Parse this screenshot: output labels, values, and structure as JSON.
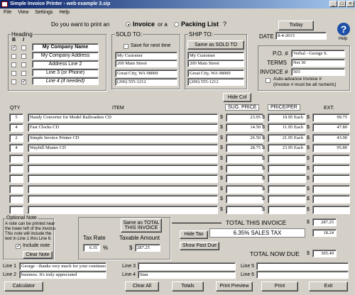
{
  "window": {
    "title": "Simple Invoice Printer - web example 3.sip"
  },
  "menu": [
    "File",
    "View",
    "Settings",
    "Help"
  ],
  "prompt": {
    "before": "Do you want to print an",
    "invoice": "Invoice",
    "or": "or a",
    "packing": "Packing List",
    "q": "?"
  },
  "heading": {
    "title": "Heading",
    "b": "B",
    "i": "I",
    "lines": [
      "My Company Name",
      "My Company Address",
      "Address Line 2",
      "Line 3 (or Phone)",
      "Line 4 (if needed)"
    ]
  },
  "sold_to": {
    "title": "SOLD TO:",
    "save": "Save for next time",
    "lines": [
      "My Customer",
      "200 Main Street",
      "Great City, WA 98000",
      "(206) 555-1212"
    ]
  },
  "ship_to": {
    "title": "SHIP TO:",
    "same_btn": "Same as SOLD TO",
    "lines": [
      "My Customer",
      "200 Main Street",
      "Great City, WA 98000",
      "(206) 555-1212"
    ]
  },
  "date": {
    "today_btn": "Today",
    "label": "DATE",
    "value": "8-4-2015"
  },
  "help": {
    "label": "Help",
    "glyph": "?"
  },
  "po": {
    "label": "P.O. #",
    "value": "Verbal - George S."
  },
  "terms": {
    "label": "TERMS",
    "value": "Net 30"
  },
  "invoice_no": {
    "label": "INVOICE #",
    "value": "503"
  },
  "auto": {
    "label": "Auto-advance Invoice #",
    "note": "(Invoice # must be all numeric)"
  },
  "hide_col": "Hide Col",
  "columns": {
    "qty": "QTY",
    "item": "ITEM",
    "sug": "SUG. PRICE",
    "price": "PRICE/PER",
    "ext": "EXT.",
    "dollar": "$"
  },
  "items": [
    {
      "qty": "5",
      "item": "Handy Converter for Model Railroaders CD",
      "sug": "23.95",
      "price": "19.95 Each",
      "ext": "99.75"
    },
    {
      "qty": "4",
      "item": "Fast Clocks CD",
      "sug": "14.50",
      "price": "11.95 Each",
      "ext": "47.80"
    },
    {
      "qty": "2",
      "item": "Simple Invoice Printer CD",
      "sug": "26.50",
      "price": "21.95 Each",
      "ext": "43.90"
    },
    {
      "qty": "4",
      "item": "Waybill Master CD",
      "sug": "28.75",
      "price": "23.95 Each",
      "ext": "95.80"
    },
    {
      "qty": "",
      "item": "",
      "sug": "",
      "price": "",
      "ext": ""
    },
    {
      "qty": "",
      "item": "",
      "sug": "",
      "price": "",
      "ext": ""
    },
    {
      "qty": "",
      "item": "",
      "sug": "",
      "price": "",
      "ext": ""
    },
    {
      "qty": "",
      "item": "",
      "sug": "",
      "price": "",
      "ext": ""
    },
    {
      "qty": "",
      "item": "",
      "sug": "",
      "price": "",
      "ext": ""
    },
    {
      "qty": "",
      "item": "",
      "sug": "",
      "price": "",
      "ext": ""
    }
  ],
  "optional_note": {
    "title": "Optional Note",
    "text": [
      "A note can be printed near",
      "the lower left of the invoice.",
      "This note will include the",
      "text in Line 1 thru Line 6."
    ],
    "include": "Include note",
    "clear_btn": "Clear Note"
  },
  "tax": {
    "same_btn": "Same as TOTAL THIS INVOICE",
    "rate_label": "Tax Rate",
    "taxable_label": "Taxable Amount",
    "rate": "6.35",
    "pct": "%",
    "taxable": "287.25",
    "dollar": "$"
  },
  "totals": {
    "total_label": "TOTAL THIS INVOICE",
    "total": "287.25",
    "sales_tax_label": "6.35% SALES TAX",
    "sales_tax": "18.24",
    "hide_tax": "Hide Tax",
    "show_past_due": "Show Past Due",
    "due_label": "TOTAL NOW DUE",
    "due": "305.49",
    "dollar": "$"
  },
  "note_lines": [
    {
      "label": "Line 1",
      "value": "George - thanks very much for your continued"
    },
    {
      "label": "Line 2",
      "value": "business. It's truly appreciated"
    },
    {
      "label": "Line 3",
      "value": ""
    },
    {
      "label": "Line 4",
      "value": "Stan"
    },
    {
      "label": "Line 5",
      "value": ""
    },
    {
      "label": "Line 6",
      "value": ""
    }
  ],
  "bottom": [
    "Calculator",
    "Clear All",
    "Totals",
    "Print Preview",
    "Print",
    "Exit"
  ]
}
